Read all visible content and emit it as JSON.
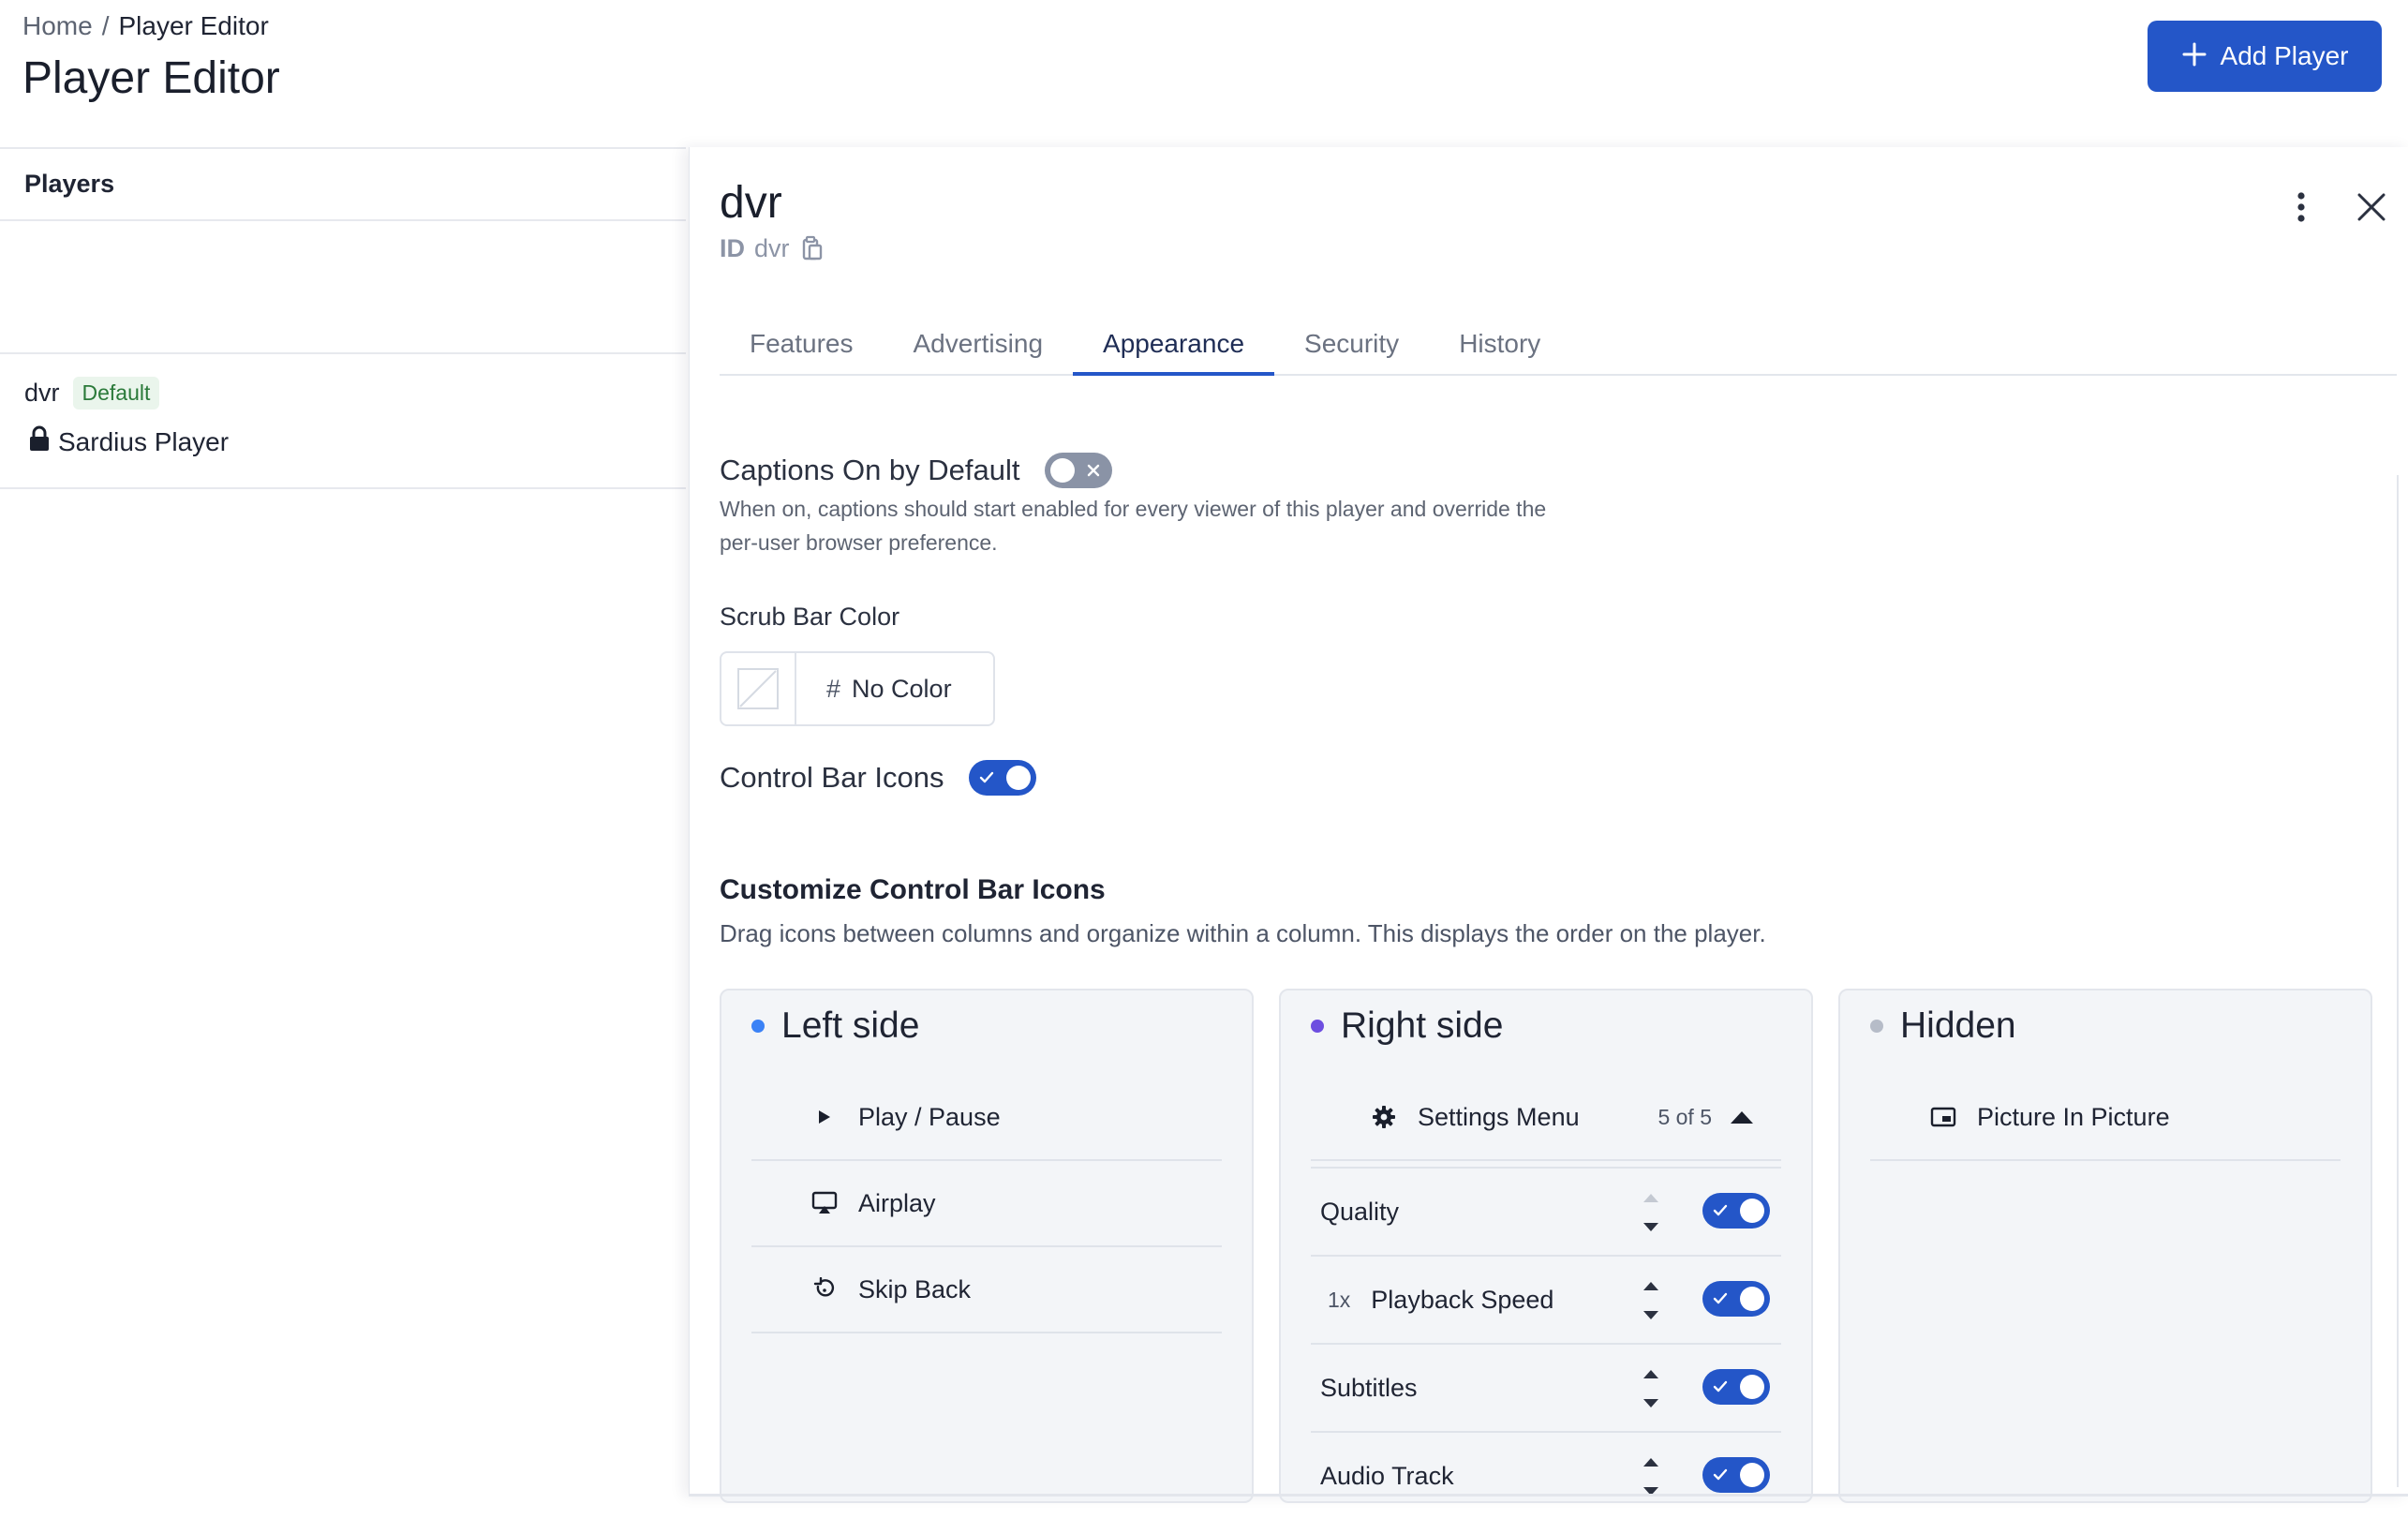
{
  "breadcrumb": {
    "home": "Home",
    "separator": "/",
    "current": "Player Editor"
  },
  "page_title": "Player Editor",
  "add_button": {
    "label": "Add Player",
    "icon": "plus-icon"
  },
  "sidebar": {
    "heading": "Players",
    "players": [
      {
        "name": "dvr",
        "badge": "Default",
        "type_icon": "lock-icon",
        "type": "Sardius Player"
      }
    ]
  },
  "panel": {
    "title": "dvr",
    "id_label": "ID",
    "id_value": "dvr",
    "tabs": [
      {
        "label": "Features",
        "active": false
      },
      {
        "label": "Advertising",
        "active": false
      },
      {
        "label": "Appearance",
        "active": true
      },
      {
        "label": "Security",
        "active": false
      },
      {
        "label": "History",
        "active": false
      }
    ],
    "captions": {
      "label": "Captions On by Default",
      "enabled": false,
      "description": "When on, captions should start enabled for every viewer of this player and override the per-user browser preference."
    },
    "scrub_bar": {
      "label": "Scrub Bar Color",
      "hash": "#",
      "value": "No Color"
    },
    "control_bar_icons": {
      "label": "Control Bar Icons",
      "enabled": true
    },
    "customize": {
      "title": "Customize Control Bar Icons",
      "description": "Drag icons between columns and organize within a column. This displays the order on the player.",
      "columns": [
        {
          "title": "Left side",
          "dot_color": "#3b82f6",
          "items": [
            {
              "label": "Play / Pause",
              "icon": "play-icon"
            },
            {
              "label": "Airplay",
              "icon": "airplay-icon"
            },
            {
              "label": "Skip Back",
              "icon": "skip-back-icon"
            }
          ]
        },
        {
          "title": "Right side",
          "dot_color": "#6d4ee0",
          "items": [
            {
              "label": "Settings Menu",
              "icon": "gear-icon",
              "count": "5 of 5",
              "expanded": true
            }
          ],
          "settings_submenu": [
            {
              "label": "Quality",
              "prefix": "",
              "enabled": true
            },
            {
              "label": "Playback Speed",
              "prefix": "1x",
              "enabled": true
            },
            {
              "label": "Subtitles",
              "prefix": "",
              "enabled": true
            },
            {
              "label": "Audio Track",
              "prefix": "",
              "enabled": true
            }
          ]
        },
        {
          "title": "Hidden",
          "dot_color": "#b6bcc8",
          "items": [
            {
              "label": "Picture In Picture",
              "icon": "picture-in-picture-icon"
            }
          ]
        }
      ]
    }
  },
  "colors": {
    "accent": "#2456c8",
    "toggle_off": "#8a93a6",
    "badge_bg": "#eaf5ec",
    "badge_text": "#2b7a3a"
  }
}
